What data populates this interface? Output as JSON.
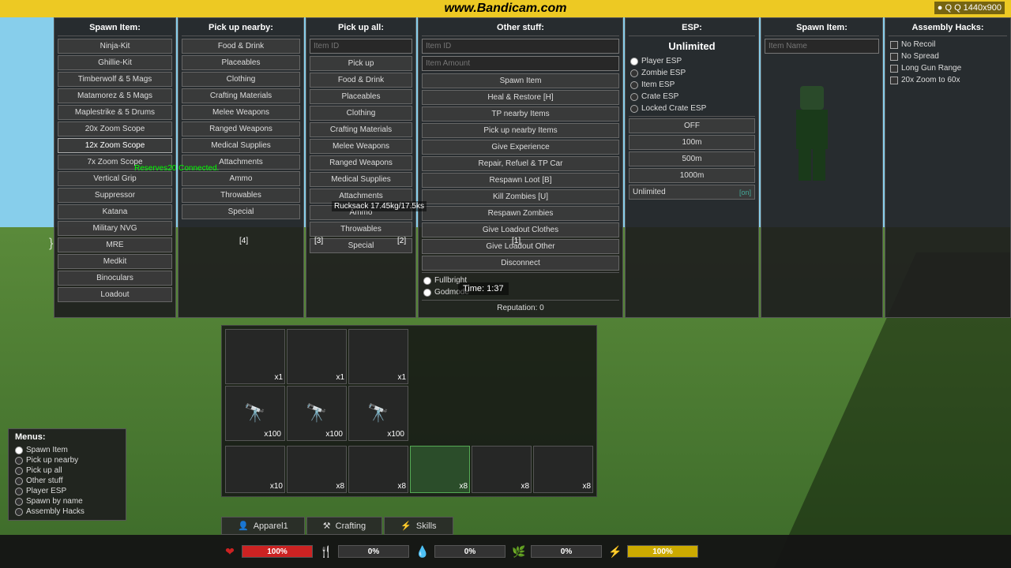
{
  "watermark": "www.Bandicam.com",
  "resolution": "Q 1440x900",
  "panels": {
    "spawn_item_left": {
      "header": "Spawn Item:",
      "items": [
        "Ninja-Kit",
        "Ghillie-Kit",
        "Timberwolf & 5 Mags",
        "Matamorez & 5 Mags",
        "Maplestrike & 5 Drums",
        "20x Zoom Scope",
        "12x Zoom Scope",
        "7x Zoom Scope",
        "Vertical Grip",
        "Suppressor",
        "Katana",
        "Military NVG",
        "MRE",
        "Medkit",
        "Binoculars",
        "Loadout"
      ]
    },
    "pick_up_nearby": {
      "header": "Pick up nearby:",
      "items": [
        "Food & Drink",
        "Placeables",
        "Clothing",
        "Crafting Materials",
        "Melee Weapons",
        "Ranged Weapons",
        "Medical Supplies",
        "Attachments",
        "Ammo",
        "Throwables",
        "Special"
      ]
    },
    "pick_up_all": {
      "header": "Pick up all:",
      "input_placeholder": "Item ID",
      "button": "Pick up",
      "items": [
        "Food & Drink",
        "Placeables",
        "Clothing",
        "Crafting Materials",
        "Melee Weapons",
        "Ranged Weapons",
        "Medical Supplies",
        "Attachments",
        "Ammo",
        "Throwables",
        "Special"
      ]
    },
    "other_stuff": {
      "header": "Other stuff:",
      "item_id_placeholder": "Item ID",
      "item_amount_placeholder": "Item Amount",
      "amount_label": "Amount",
      "buttons": [
        "Spawn Item",
        "Heal & Restore [H]",
        "TP nearby Items",
        "Pick up nearby Items",
        "Give Experience",
        "Repair, Refuel & TP Car",
        "Respawn Loot [B]",
        "Kill Zombies [U]",
        "Respawn Zombies",
        "Give Loadout Clothes",
        "Give Loadout Other",
        "Disconnect"
      ],
      "radios": [
        {
          "label": "Fullbright",
          "active": true
        },
        {
          "label": "Godmode",
          "active": true
        }
      ],
      "reputation_label": "Reputation: 0"
    },
    "esp": {
      "header": "ESP:",
      "unlimited_label": "Unlimited",
      "radio_items": [
        {
          "label": "Player ESP",
          "active": true
        },
        {
          "label": "Zombie ESP",
          "active": false
        },
        {
          "label": "Item ESP",
          "active": false
        },
        {
          "label": "Crate ESP",
          "active": false
        },
        {
          "label": "Locked Crate ESP",
          "active": false
        }
      ],
      "range_buttons": [
        {
          "label": "OFF",
          "active": false
        },
        {
          "label": "100m",
          "active": false
        },
        {
          "label": "500m",
          "active": false
        },
        {
          "label": "1000m",
          "active": false
        },
        {
          "label": "Unlimited",
          "active": false
        }
      ]
    },
    "spawn_item_right": {
      "header": "Spawn Item:",
      "input_placeholder": "Item Name"
    },
    "assembly_hacks": {
      "header": "Assembly Hacks:",
      "checkboxes": [
        {
          "label": "No Recoil",
          "checked": false
        },
        {
          "label": "No Spread",
          "checked": false
        },
        {
          "label": "Long Gun Range",
          "checked": false
        },
        {
          "label": "20x Zoom to 60x",
          "checked": false
        }
      ]
    }
  },
  "overlays": {
    "connected_text": "Reserves20 Connected.",
    "rucksack_text": "Rucksack 17.45kg/17.5ks",
    "time_text": "Time: 1:37"
  },
  "inventory": {
    "slots": [
      [
        {
          "count": "x1",
          "has_item": false
        },
        {
          "count": "x1",
          "has_item": false
        },
        {
          "count": "x1",
          "has_item": false
        }
      ],
      [
        {
          "count": "x100",
          "has_item": true
        },
        {
          "count": "x100",
          "has_item": true
        },
        {
          "count": "x100",
          "has_item": true
        }
      ]
    ],
    "bottom_slots": [
      {
        "count": "x10",
        "has_item": false
      },
      {
        "count": "x8",
        "has_item": false
      },
      {
        "count": "x8",
        "has_item": false
      },
      {
        "count": "x8",
        "has_item": true
      },
      {
        "count": "x8",
        "has_item": false
      },
      {
        "count": "x8",
        "has_item": false
      }
    ]
  },
  "bottom_tabs": [
    {
      "label": "Apparel1",
      "icon": "👤",
      "active": false
    },
    {
      "label": "Crafting",
      "icon": "⚒",
      "active": false
    },
    {
      "label": "Skills",
      "icon": "⚡",
      "active": false
    }
  ],
  "status_bars": [
    {
      "icon": "❤",
      "color": "#cc2222",
      "fill": 100,
      "text": "100%"
    },
    {
      "icon": "🍴",
      "color": "#888",
      "fill": 0,
      "text": "0%"
    },
    {
      "icon": "💧",
      "color": "#3399cc",
      "fill": 0,
      "text": "0%"
    },
    {
      "icon": "🌿",
      "color": "#33aa33",
      "fill": 0,
      "text": "0%"
    },
    {
      "icon": "⚡",
      "color": "#ccaa00",
      "fill": 100,
      "text": "100%"
    }
  ],
  "left_menus": {
    "title": "Menus:",
    "items": [
      {
        "label": "Spawn Item",
        "active": true
      },
      {
        "label": "Pick up nearby",
        "active": false
      },
      {
        "label": "Pick up all",
        "active": false
      },
      {
        "label": "Other stuff",
        "active": false
      },
      {
        "label": "Player ESP",
        "active": false
      },
      {
        "label": "Spawn by name",
        "active": false
      },
      {
        "label": "Assembly Hacks",
        "active": false
      }
    ]
  },
  "labels": {
    "panels_row1": [
      "[1]",
      "[2]",
      "[3]",
      "[4]"
    ],
    "zoom_scope": "Zoom Scope",
    "ammo": "Ammo",
    "clothing_top": "Clothing",
    "clothing_pick": "Clothing",
    "ranged_weapons": "Ranged Weapons",
    "locked_crate_esp": "Locked Crate ESP"
  },
  "icons": {
    "record": "●",
    "camera": "📷"
  }
}
